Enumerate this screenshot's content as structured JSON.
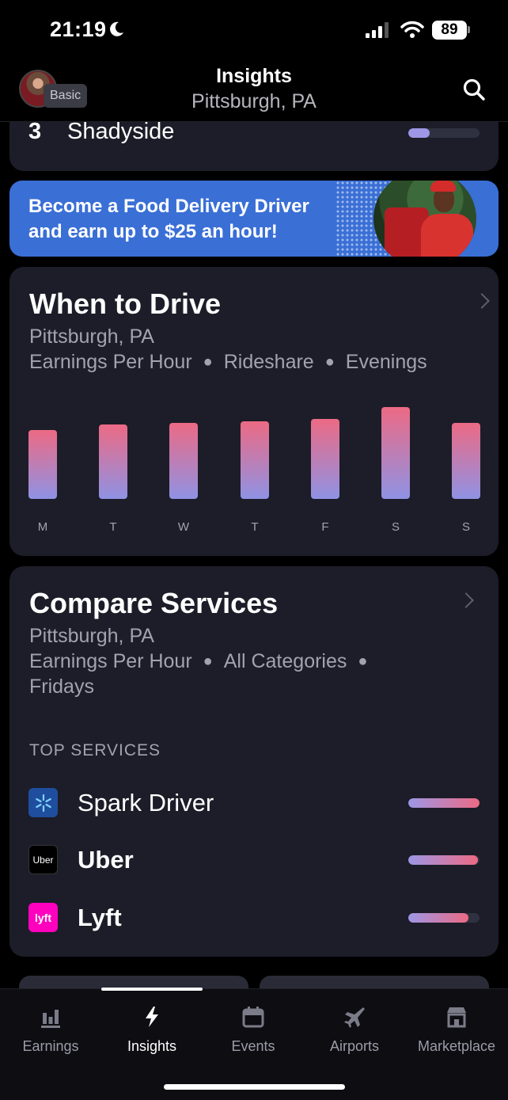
{
  "status_bar": {
    "time": "21:19",
    "battery_level": "89",
    "icons": [
      "moon-icon",
      "signal-icon",
      "wifi-icon",
      "battery-icon"
    ]
  },
  "header": {
    "title": "Insights",
    "location": "Pittsburgh, PA",
    "plan_badge": "Basic",
    "search_icon": "search-icon"
  },
  "top_area": {
    "rank_number": "3",
    "rank_name": "Shadyside",
    "rank_level": 0.3
  },
  "promo": {
    "line1": "Become a Food Delivery Driver",
    "line2": "and earn up to $25 an hour!"
  },
  "when_to_drive": {
    "title": "When to Drive",
    "location": "Pittsburgh, PA",
    "filters": [
      "Earnings Per Hour",
      "Rideshare",
      "Evenings"
    ],
    "chart_data": {
      "type": "bar",
      "categories": [
        "M",
        "T",
        "W",
        "T",
        "F",
        "S",
        "S"
      ],
      "values": [
        81,
        88,
        90,
        91,
        94,
        108,
        90
      ],
      "ylim": [
        0,
        112
      ]
    }
  },
  "compare_services": {
    "title": "Compare Services",
    "location": "Pittsburgh, PA",
    "filters_line1": [
      "Earnings Per Hour",
      "All Categories"
    ],
    "filters_line2": "Fridays",
    "section_label": "TOP SERVICES",
    "services": [
      {
        "name": "Spark Driver",
        "logo": "spark-driver-logo",
        "logo_color": "#1f4e9e",
        "level": 1.0
      },
      {
        "name": "Uber",
        "logo": "uber-logo",
        "logo_text": "Uber",
        "logo_color": "#000000",
        "level": 0.98
      },
      {
        "name": "Lyft",
        "logo": "lyft-logo",
        "logo_text": "lyft",
        "logo_color": "#ff00bf",
        "level": 0.84
      }
    ]
  },
  "tab_bar": {
    "tabs": [
      {
        "label": "Earnings",
        "icon": "bar-chart-icon"
      },
      {
        "label": "Insights",
        "icon": "lightning-icon",
        "active": true
      },
      {
        "label": "Events",
        "icon": "calendar-icon"
      },
      {
        "label": "Airports",
        "icon": "airplane-icon"
      },
      {
        "label": "Marketplace",
        "icon": "storefront-icon"
      }
    ]
  },
  "colors": {
    "background": "#000000",
    "card": "#1c1d28",
    "promo": "#3a6fd6",
    "bar_top": "#ec6a84",
    "bar_bottom": "#8f92e4",
    "muted_text": "#a2a3ae"
  }
}
